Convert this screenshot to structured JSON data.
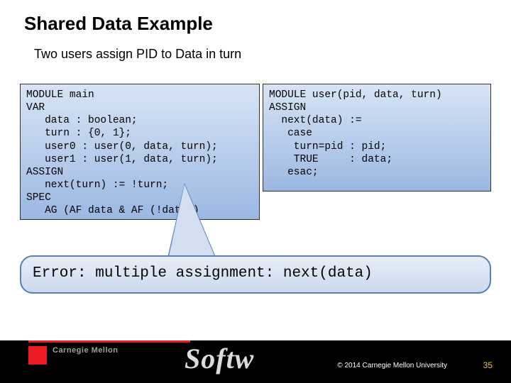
{
  "title": "Shared Data Example",
  "subtitle": "Two users assign PID to Data in turn",
  "code_main": "MODULE main\nVAR\n   data : boolean;\n   turn : {0, 1};\n   user0 : user(0, data, turn);\n   user1 : user(1, data, turn);\nASSIGN\n   next(turn) := !turn;\nSPEC\n   AG (AF data & AF (!data))",
  "code_user": "MODULE user(pid, data, turn)\nASSIGN\n  next(data) :=\n   case\n    turn=pid : pid;\n    TRUE     : data;\n   esac;",
  "error_text": "Error: multiple assignment: next(data)",
  "footer": {
    "carnegie": "Carnegie Mellon",
    "brand": "Softw",
    "copyright": "© 2014 Carnegie Mellon University",
    "page": "35"
  }
}
